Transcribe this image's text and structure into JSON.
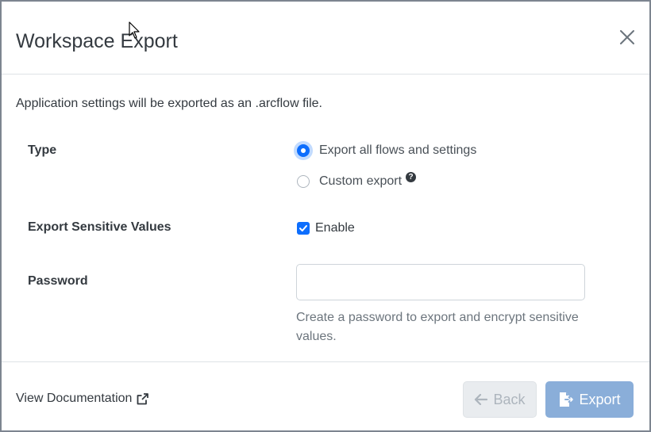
{
  "dialog": {
    "title": "Workspace Export",
    "intro": "Application settings will be exported as an .arcflow file."
  },
  "type": {
    "label": "Type",
    "options": [
      {
        "label": "Export all flows and settings",
        "selected": true
      },
      {
        "label": "Custom export",
        "selected": false
      }
    ],
    "help_icon": "question-circle-icon"
  },
  "sensitive": {
    "label": "Export Sensitive Values",
    "checkbox_label": "Enable",
    "checked": true
  },
  "password": {
    "label": "Password",
    "value": "",
    "hint": "Create a password to export and encrypt sensitive values."
  },
  "footer": {
    "doc_link": "View Documentation",
    "back_label": "Back",
    "export_label": "Export"
  },
  "colors": {
    "primary": "#0d6efd",
    "export_disabled": "#8aaed9",
    "back_bg": "#e9ecef"
  }
}
